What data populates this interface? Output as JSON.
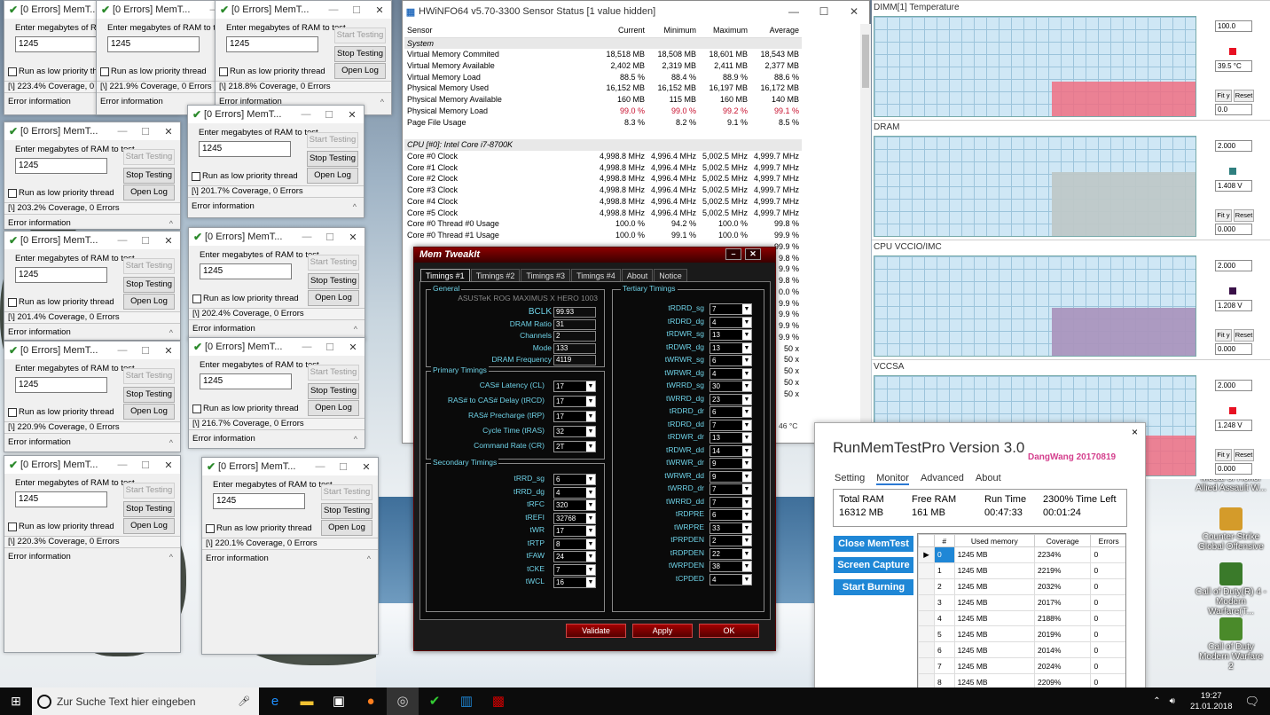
{
  "memtest": {
    "title": "[0 Errors] MemT...",
    "prompt": "Enter megabytes of RAM to test",
    "value": "1245",
    "start": "Start Testing",
    "stop": "Stop Testing",
    "lowprio": "Run as low priority thread",
    "openlog": "Open Log",
    "errinfo": "Error information",
    "w1_coverage": "[\\]  223.4% Coverage, 0 Errors",
    "w2_coverage": "[\\]  221.9% Coverage, 0 Errors",
    "w3_coverage": "[\\]  218.8% Coverage, 0 Errors",
    "w4_coverage": "[\\]  203.2% Coverage, 0 Errors",
    "w5_coverage": "[\\]  201.7% Coverage, 0 Errors",
    "w6_coverage": "[\\]  201.4% Coverage, 0 Errors",
    "w7_coverage": "[\\]  202.4% Coverage, 0 Errors",
    "w8_coverage": "[\\]  220.9% Coverage, 0 Errors",
    "w9_coverage": "[\\]  216.7% Coverage, 0 Errors",
    "w10_coverage": "[\\]  220.3% Coverage, 0 Errors",
    "w11_coverage": "[\\]  220.1% Coverage, 0 Errors"
  },
  "hwinfo": {
    "title": "HWiNFO64 v5.70-3300 Sensor Status [1 value hidden]",
    "headers": [
      "Sensor",
      "Current",
      "Minimum",
      "Maximum",
      "Average"
    ],
    "group_system": "System",
    "group_cpu": "CPU [#0]: Intel Core i7-8700K",
    "rows": [
      [
        "Virtual Memory Commited",
        "18,518 MB",
        "18,508 MB",
        "18,601 MB",
        "18,543 MB"
      ],
      [
        "Virtual Memory Available",
        "2,402 MB",
        "2,319 MB",
        "2,411 MB",
        "2,377 MB"
      ],
      [
        "Virtual Memory Load",
        "88.5 %",
        "88.4 %",
        "88.9 %",
        "88.6 %"
      ],
      [
        "Physical Memory Used",
        "16,152 MB",
        "16,152 MB",
        "16,197 MB",
        "16,172 MB"
      ],
      [
        "Physical Memory Available",
        "160 MB",
        "115 MB",
        "160 MB",
        "140 MB"
      ],
      [
        "Physical Memory Load",
        "99.0 %",
        "99.0 %",
        "99.2 %",
        "99.1 %"
      ],
      [
        "Page File Usage",
        "8.3 %",
        "8.2 %",
        "9.1 %",
        "8.5 %"
      ]
    ],
    "cpu_rows": [
      [
        "Core #0 Clock",
        "4,998.8 MHz",
        "4,996.4 MHz",
        "5,002.5 MHz",
        "4,999.7 MHz"
      ],
      [
        "Core #1 Clock",
        "4,998.8 MHz",
        "4,996.4 MHz",
        "5,002.5 MHz",
        "4,999.7 MHz"
      ],
      [
        "Core #2 Clock",
        "4,998.8 MHz",
        "4,996.4 MHz",
        "5,002.5 MHz",
        "4,999.7 MHz"
      ],
      [
        "Core #3 Clock",
        "4,998.8 MHz",
        "4,996.4 MHz",
        "5,002.5 MHz",
        "4,999.7 MHz"
      ],
      [
        "Core #4 Clock",
        "4,998.8 MHz",
        "4,996.4 MHz",
        "5,002.5 MHz",
        "4,999.7 MHz"
      ],
      [
        "Core #5 Clock",
        "4,998.8 MHz",
        "4,996.4 MHz",
        "5,002.5 MHz",
        "4,999.7 MHz"
      ],
      [
        "Core #0 Thread #0 Usage",
        "100.0 %",
        "94.2 %",
        "100.0 %",
        "99.8 %"
      ],
      [
        "Core #0 Thread #1 Usage",
        "100.0 %",
        "99.1 %",
        "100.0 %",
        "99.9 %"
      ]
    ],
    "hidden_avgs": [
      "99.9 %",
      "9.8 %",
      "9.9 %",
      "9.8 %",
      "0.0 %",
      "9.9 %",
      "9.9 %",
      "9.9 %",
      "9.9 %",
      "50 x",
      "50 x",
      "50 x",
      "50 x",
      "50 x"
    ],
    "temp_partial": "46 °C"
  },
  "graphs": [
    {
      "title": "DIMM[1] Temperature",
      "max": "100.0",
      "cur": "39.5 °C",
      "min": "0.0",
      "color": "#e81123"
    },
    {
      "title": "DRAM",
      "max": "2.000",
      "cur": "1.408 V",
      "min": "0.000",
      "color": "#2f7f7f"
    },
    {
      "title": "CPU VCCIO/IMC",
      "max": "2.000",
      "cur": "1.208 V",
      "min": "0.000",
      "color": "#3a1048"
    },
    {
      "title": "VCCSA",
      "max": "2.000",
      "cur": "1.248 V",
      "min": "0.000",
      "color": "#e81123"
    }
  ],
  "graph_buttons": {
    "fit": "Fit y",
    "reset": "Reset"
  },
  "memtweak": {
    "title": "Mem TweakIt",
    "tabs": [
      "Timings #1",
      "Timings #2",
      "Timings #3",
      "Timings #4",
      "About",
      "Notice"
    ],
    "general_label": "General",
    "board": "ASUSTeK ROG MAXIMUS X HERO 1003",
    "general": [
      [
        "BCLK",
        "99.93"
      ],
      [
        "DRAM Ratio",
        "31"
      ],
      [
        "Channels",
        "2"
      ],
      [
        "Mode",
        "133"
      ],
      [
        "DRAM Frequency",
        "4119"
      ]
    ],
    "primary_label": "Primary Timings",
    "primary": [
      [
        "CAS# Latency (CL)",
        "17"
      ],
      [
        "RAS# to CAS# Delay (tRCD)",
        "17"
      ],
      [
        "RAS# Precharge (tRP)",
        "17"
      ],
      [
        "Cycle Time (tRAS)",
        "32"
      ],
      [
        "Command Rate (CR)",
        "2T"
      ]
    ],
    "secondary_label": "Secondary Timings",
    "secondary": [
      [
        "tRRD_sg",
        "6"
      ],
      [
        "tRRD_dg",
        "4"
      ],
      [
        "tRFC",
        "320"
      ],
      [
        "tREFI",
        "32768"
      ],
      [
        "tWR",
        "17"
      ],
      [
        "tRTP",
        "8"
      ],
      [
        "tFAW",
        "24"
      ],
      [
        "tCKE",
        "7"
      ],
      [
        "tWCL",
        "16"
      ]
    ],
    "tertiary_label": "Tertiary Timings",
    "tertiary": [
      [
        "tRDRD_sg",
        "7"
      ],
      [
        "tRDRD_dg",
        "4"
      ],
      [
        "tRDWR_sg",
        "13"
      ],
      [
        "tRDWR_dg",
        "13"
      ],
      [
        "tWRWR_sg",
        "6"
      ],
      [
        "tWRWR_dg",
        "4"
      ],
      [
        "tWRRD_sg",
        "30"
      ],
      [
        "tWRRD_dg",
        "23"
      ],
      [
        "tRDRD_dr",
        "6"
      ],
      [
        "tRDRD_dd",
        "7"
      ],
      [
        "tRDWR_dr",
        "13"
      ],
      [
        "tRDWR_dd",
        "14"
      ],
      [
        "tWRWR_dr",
        "9"
      ],
      [
        "tWRWR_dd",
        "9"
      ],
      [
        "tWRRD_dr",
        "7"
      ],
      [
        "tWRRD_dd",
        "7"
      ],
      [
        "tRDPRE",
        "6"
      ],
      [
        "tWRPRE",
        "33"
      ],
      [
        "tPRPDEN",
        "2"
      ],
      [
        "tRDPDEN",
        "22"
      ],
      [
        "tWRPDEN",
        "38"
      ],
      [
        "tCPDED",
        "4"
      ]
    ],
    "validate": "Validate",
    "apply": "Apply",
    "ok": "OK"
  },
  "runmemtest": {
    "title": "RunMemTestPro Version 3.0",
    "author": "DangWang  20170819",
    "close": "×",
    "menu": [
      "Setting",
      "Monitor",
      "Advanced",
      "About"
    ],
    "total_ram_label": "Total RAM",
    "total_ram": "16312 MB",
    "free_ram_label": "Free RAM",
    "free_ram": "161 MB",
    "runtime_label": "Run Time",
    "runtime": "00:47:33",
    "timeleft_label": "2300% Time Left",
    "timeleft": "00:01:24",
    "btn_close": "Close MemTest",
    "btn_capture": "Screen Capture",
    "btn_burn": "Start Burning",
    "cols": [
      "#",
      "Used memory",
      "Coverage",
      "Errors"
    ],
    "rows": [
      [
        "0",
        "1245 MB",
        "2234%",
        "0"
      ],
      [
        "1",
        "1245 MB",
        "2219%",
        "0"
      ],
      [
        "2",
        "1245 MB",
        "2032%",
        "0"
      ],
      [
        "3",
        "1245 MB",
        "2017%",
        "0"
      ],
      [
        "4",
        "1245 MB",
        "2188%",
        "0"
      ],
      [
        "5",
        "1245 MB",
        "2019%",
        "0"
      ],
      [
        "6",
        "1245 MB",
        "2014%",
        "0"
      ],
      [
        "7",
        "1245 MB",
        "2024%",
        "0"
      ],
      [
        "8",
        "1245 MB",
        "2209%",
        "0"
      ],
      [
        "9",
        "1245 MB",
        "2167%",
        "0"
      ],
      [
        "10",
        "1245 MB",
        "2203%",
        "0"
      ]
    ]
  },
  "desktop_icons": [
    {
      "label": "Counter-Strike Global Offensive"
    },
    {
      "label": "Call of Duty(R) 4 - Modern Warfare(T..."
    },
    {
      "label": "Call of Duty Modern Warfare 2"
    },
    {
      "label": "Medal of Honor Allied Assault W..."
    }
  ],
  "taskbar": {
    "search_placeholder": "Zur Suche Text hier eingeben",
    "time": "19:27",
    "date": "21.01.2018"
  }
}
